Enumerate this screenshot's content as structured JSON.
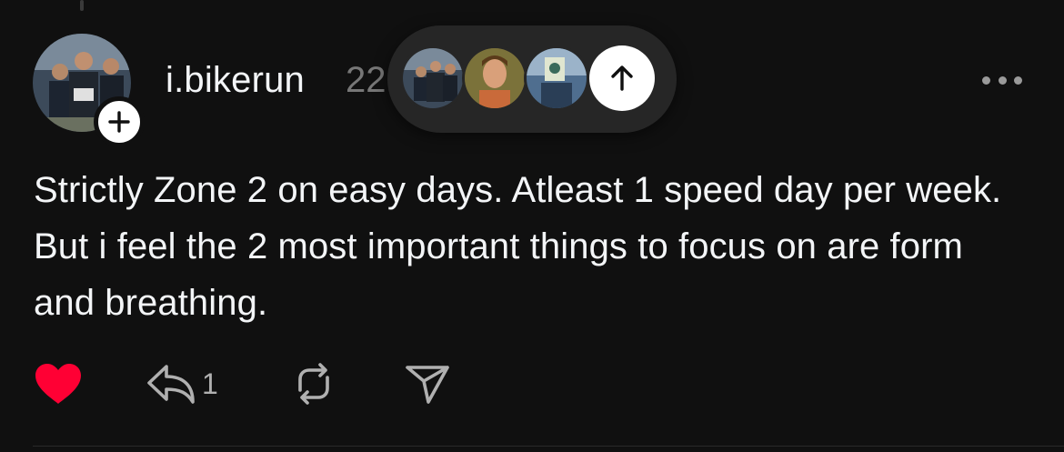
{
  "post": {
    "username": "i.bikerun",
    "timestamp": "22",
    "text": "Strictly Zone 2 on easy days. Atleast 1 speed day per week. But i feel the 2 most important things to focus on are form and breathing.",
    "reply_count": "1",
    "liked": true
  },
  "icons": {
    "follow": "plus-icon",
    "more": "more-horizontal-icon",
    "like": "heart-icon",
    "reply": "reply-arrow-icon",
    "repost": "repost-icon",
    "share": "send-icon",
    "scroll_up": "arrow-up-icon"
  },
  "colors": {
    "background": "#101010",
    "text": "#f3f5f7",
    "muted": "#777777",
    "like": "#ff0034",
    "pill": "#262626"
  }
}
